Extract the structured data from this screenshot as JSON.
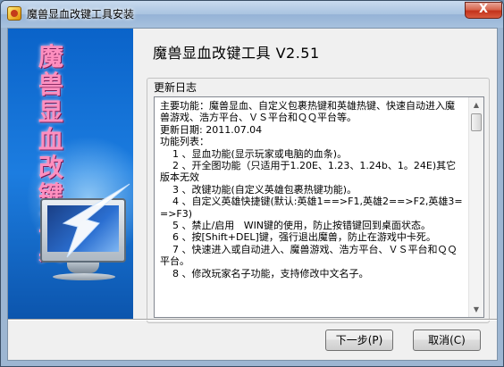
{
  "window": {
    "title": "魔兽显血改键工具安装",
    "close_label": "X"
  },
  "side_panel": {
    "vertical_title": "魔兽显血改键工具"
  },
  "heading": "魔兽显血改键工具 V2.51",
  "log": {
    "label": "更新日志",
    "lines": [
      "主要功能：魔兽显血、自定义包裹热键和英雄热键、快速自动进入魔兽游戏、浩方平台、ＶＳ平台和ＱＱ平台等。",
      "更新日期: 2011.07.04",
      "功能列表：",
      "    1 、显血功能(显示玩家或电脑的血条)。",
      "    2 、开全图功能（只适用于1.20E、1.23、1.24b、1。24E)其它版本无效",
      "    3 、改键功能(自定义英雄包裹热键功能)。",
      "    4 、自定义英雄快捷键(默认:英雄1==>F1,英雄2==>F2,英雄3==>F3)",
      "    5 、禁止/启用   WIN键的使用，防止按错键回到桌面状态。",
      "    6 、按[Shift+DEL]键，强行退出魔兽，防止在游戏中卡死。",
      "    7 、快速进入或自动进入、魔兽游戏、浩方平台、ＶＳ平台和ＱＱ平台。",
      "    8 、修改玩家名子功能，支持修改中文名子。"
    ]
  },
  "buttons": {
    "next": "下一步(P)",
    "cancel": "取消(C)"
  },
  "colors": {
    "side_panel": "#1c7de0",
    "side_title": "#ff8fbf",
    "close_button": "#c3321b"
  }
}
